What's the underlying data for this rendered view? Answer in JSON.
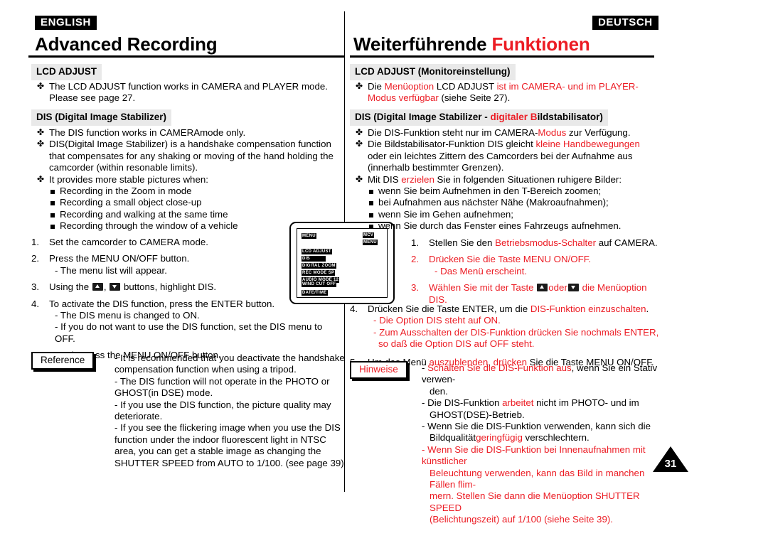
{
  "left": {
    "language_badge": "ENGLISH",
    "page_title": "Advanced Recording",
    "section_lcd": "LCD ADJUST",
    "lcd_bullets": [
      "The LCD ADJUST function works in CAMERA and PLAYER mode. Please see page 27."
    ],
    "section_dis": "DIS (Digital Image Stabilizer)",
    "dis_bullets": [
      "The DIS function works in CAMERAmode only.",
      "DIS(Digital Image Stabilizer) is a handshake compensation function that compensates for any shaking or moving of the hand holding the camcorder (within resonable limits).",
      "It provides more stable pictures when:"
    ],
    "dis_sub_bullets": [
      "Recording in the Zoom in mode",
      "Recording a small object close-up",
      "Recording and walking at the same time",
      "Recording through the window of a vehicle"
    ],
    "steps": [
      {
        "num": "1.",
        "text": "Set the camcorder to CAMERA mode.",
        "subs": []
      },
      {
        "num": "2.",
        "text": "Press the MENU ON/OFF button.",
        "subs": [
          "- The menu list will appear."
        ]
      },
      {
        "num": "3.",
        "text_before": "Using the ",
        "text_mid": ", ",
        "text_after": " buttons, highlight DIS.",
        "subs": []
      },
      {
        "num": "4.",
        "text": "To activate the DIS function, press the ENTER button.",
        "subs": [
          "- The DIS menu is changed to ON.",
          "- If you do not want to use the DIS function, set the DIS menu to OFF."
        ]
      },
      {
        "num": "5.",
        "text": "To exit, press the MENU ON/OFF button.",
        "subs": []
      }
    ],
    "note_label": "Reference",
    "notes": [
      "- It is recommended that you deactivate the handshake compensation function when using a tripod.",
      "- The DIS function will not operate in the PHOTO or GHOST(in DSE) mode.",
      "- If you use the DIS function, the picture quality may deteriorate.",
      "- If you see the flickering image when you use the DIS function under the indoor fluorescent light in NTSC area, you can get a stable image as changing the SHUTTER SPEED from AUTO to 1/100. (see page 39)"
    ]
  },
  "right": {
    "language_badge": "DEUTSCH",
    "page_title_black": "Weiterführende ",
    "page_title_red": "Funktionen",
    "section_lcd": "LCD ADJUST (Monitoreinstellung)",
    "section_lcd_parts": {
      "a": "LCD ADJUST (Monitoreinstellung)"
    },
    "lcd_bullet_parts": {
      "p1": "Die ",
      "p2": "Menüoption",
      "p3": " LCD ADJUST ",
      "p4": "ist im CAMERA- und im PLAYER-",
      "p5": "Modus verfügbar",
      "p6": " (siehe Seite 27)."
    },
    "section_dis_black": "DIS (Digital Image Stabilizer - ",
    "section_dis_red": "digitaler B",
    "section_dis_black2": "ildstabilisator)",
    "dis_b1": {
      "a": "Die DIS-Funktion steht nur im CAMERA-",
      "b": "Modus",
      "c": " zur Verfügung."
    },
    "dis_b2": {
      "a": "Die Bildstabilisator-Funktion DIS gleicht ",
      "b": "kleine Handbewegungen",
      "c": " oder ein leichtes Zittern des Camcorders bei der Aufnahme aus (innerhalb bestimmter Grenzen)."
    },
    "dis_b3": {
      "a": "Mit DIS ",
      "b": "erzielen",
      "c": " Sie in folgenden Situationen ruhigere Bilder:"
    },
    "dis_sub_bullets": [
      "wenn Sie beim Aufnehmen in den T-Bereich zoomen;",
      "bei Aufnahmen aus nächster Nähe (Makroaufnahmen);",
      "wenn Sie im Gehen aufnehmen;",
      "wenn Sie durch das Fenster eines Fahrzeugs aufnehmen."
    ],
    "step1": {
      "num": "1.",
      "a": "Stellen Sie den ",
      "b": "Betriebsmodus-Schalter",
      "c": " auf CAMERA."
    },
    "step2": {
      "num": "2.",
      "a": "Drücken Sie die Taste MENU ON/OFF.",
      "sub": "- Das Menü erscheint."
    },
    "step3": {
      "num": "3.",
      "a": "Wählen Sie mit der Taste ",
      "b": "oder",
      "c": " die Menüoption",
      "d": "DIS."
    },
    "step4": {
      "num": "4.",
      "a": "Drücken Sie die Taste ENTER, um die ",
      "b": "DIS-Funktion einzuschalten",
      "c": ".",
      "sub1": "- Die Option DIS steht auf ON.",
      "sub2": "- Zum Ausschalten der DIS-Funktion drücken Sie nochmals ENTER,",
      "sub3": "so daß die Option DIS auf OFF steht."
    },
    "step5": {
      "num": "5.",
      "a": "Um das Menü ",
      "b": "auszublenden",
      "c": ", ",
      "d": "drücken",
      "e": " Sie die Taste MENU ON/OFF."
    },
    "note_label": "Hinweise",
    "note1": {
      "a": "- ",
      "b": "Schalten Sie die DIS-Funktion aus",
      "c": ", wenn Sie ein Stativ verwen-",
      "d": "den."
    },
    "note2": {
      "a": "- Die DIS-Funktion ",
      "b": "arbeitet",
      "c": " nicht im PHOTO- und im",
      "d": "GHOST(DSE)-Betrieb."
    },
    "note3": {
      "a": "- Wenn Sie die DIS-Funktion verwenden, kann sich die",
      "b": "Bildqualität ",
      "c": "geringfügig",
      "d": " verschlechtern."
    },
    "note4": {
      "a": "- Wenn Sie die DIS-Funktion bei Innenaufnahmen mit künstlicher",
      "b": "Beleuchtung verwenden, kann das Bild in manchen Fällen flim-",
      "c": "mern. Stellen Sie dann die Menüoption SHUTTER SPEED",
      "d": "(Belichtungszeit) auf 1/100 (siehe Seite 39)."
    }
  },
  "lcd_illustration": {
    "title": "MENU",
    "corner_top": "MCV",
    "corner_sub": "MENU",
    "rows": [
      {
        "label": "LCD ADJUST",
        "selected": false
      },
      {
        "label": "DIS",
        "selected": true
      },
      {
        "label": "DIGITAL ZOOM",
        "selected": false
      },
      {
        "label": "REC MODE SP",
        "selected": true
      },
      {
        "label": "AUDIO MODE 12",
        "selected": true
      },
      {
        "label": "WIND CUT OFF",
        "selected": true
      },
      {
        "label": "DATE/TIME",
        "selected": true
      }
    ]
  },
  "page_number": "31",
  "colors": {
    "accent_red": "#ec1c24",
    "header_gray": "#e9e9e9",
    "ink": "#000000"
  }
}
